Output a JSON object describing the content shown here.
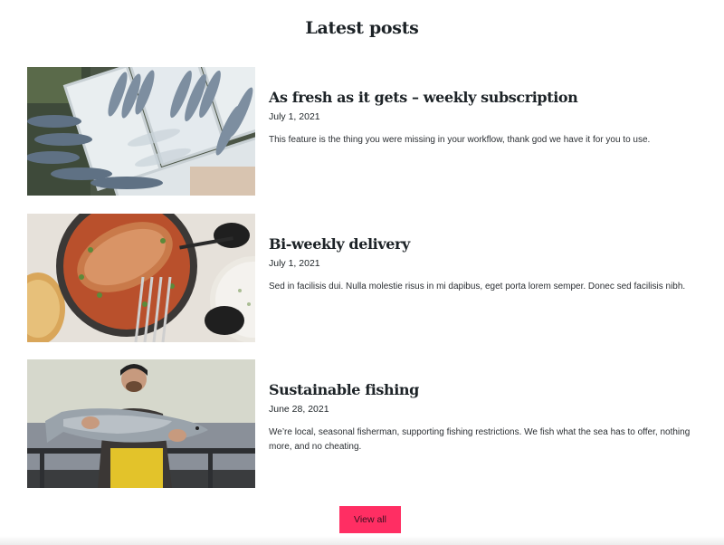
{
  "section": {
    "title": "Latest posts"
  },
  "posts": [
    {
      "title": "As fresh as it gets – weekly subscription",
      "date": "July 1, 2021",
      "excerpt": "This feature is the thing you were missing in your workflow, thank god we have it for you to use.",
      "image_alt": "Crates of fresh fish on ice"
    },
    {
      "title": "Bi-weekly delivery",
      "date": "July 1, 2021",
      "excerpt": "Sed in facilisis dui. Nulla molestie risus in mi dapibus, eget porta lorem semper. Donec sed facilisis nibh.",
      "image_alt": "Roasted fish in a pan with side dishes"
    },
    {
      "title": "Sustainable fishing",
      "date": "June 28, 2021",
      "excerpt": "We’re local, seasonal fisherman, supporting fishing restrictions. We fish what the sea has to offer, nothing more, and no cheating.",
      "image_alt": "Fisherman holding a large salmon on a boat"
    }
  ],
  "view_all": {
    "label": "View all"
  },
  "colors": {
    "accent": "#ff2e63",
    "text": "#1d2327",
    "background": "#ffffff"
  }
}
